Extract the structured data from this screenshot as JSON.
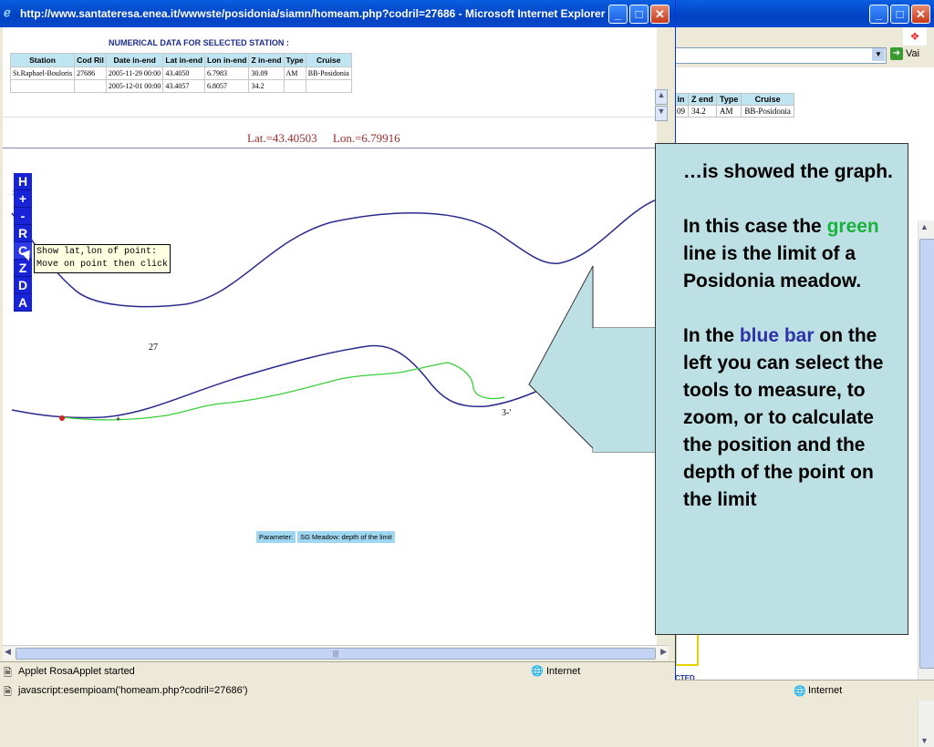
{
  "popup": {
    "title": "http://www.santateresa.enea.it/wwwste/posidonia/siamn/homeam.php?codril=27686 - Microsoft Internet Explorer",
    "numerical_heading": "NUMERICAL DATA FOR SELECTED STATION :",
    "table": {
      "headers": [
        "Station",
        "Cod Ril",
        "Date in-end",
        "Lat in-end",
        "Lon in-end",
        "Z in-end",
        "Type",
        "Cruise"
      ],
      "rows": [
        [
          "St.Raphael-Bouloris",
          "27686",
          "2005-11-29 00:00",
          "43.4050",
          "6.7983",
          "30.09",
          "AM",
          "BB-Posidonia"
        ],
        [
          "",
          "",
          "2005-12-01 00:00",
          "43.4057",
          "6.8057",
          "34.2",
          "",
          ""
        ]
      ]
    },
    "coord_lat": "Lat.=43.40503",
    "coord_lon": "Lon.=6.79916",
    "tools": [
      "H",
      "+",
      "-",
      "R",
      "C",
      "Z",
      "D",
      "A"
    ],
    "tooltip_line1": "Show lat,lon of point:",
    "tooltip_line2": "Move on point then click",
    "label_27": "27",
    "label_3": "3-'",
    "param_label": "Parameter:",
    "param_value": "SG Meadow: depth of the limit",
    "status_text": "Applet RosaApplet started",
    "status_zone": "Internet"
  },
  "background": {
    "go_label": "Vai",
    "table": {
      "headers": [
        "in",
        "Z end",
        "Type",
        "Cruise"
      ],
      "rows": [
        [
          "09",
          "34.2",
          "AM",
          "BB-Posidonia"
        ]
      ]
    },
    "status_text": "javascript:esempioam('homeam.php?codril=27686')",
    "status_zone": "Internet",
    "partial_label": "CTED"
  },
  "callout": {
    "p1": "…is showed the graph.",
    "p2_a": "In this case the ",
    "p2_green": "green",
    "p2_b": " line is the limit of a Posidonia meadow.",
    "p3_a": "In the ",
    "p3_blue": "blue bar",
    "p3_b": " on the left you can select the tools to measure, to zoom, or to calculate the position and the depth of the point on  the limit"
  },
  "colors": {
    "blue_line": "#2a2a8c",
    "green_line": "#3ccf3c",
    "toolbar": "#1822d6",
    "callout_bg": "#bce0e4"
  }
}
